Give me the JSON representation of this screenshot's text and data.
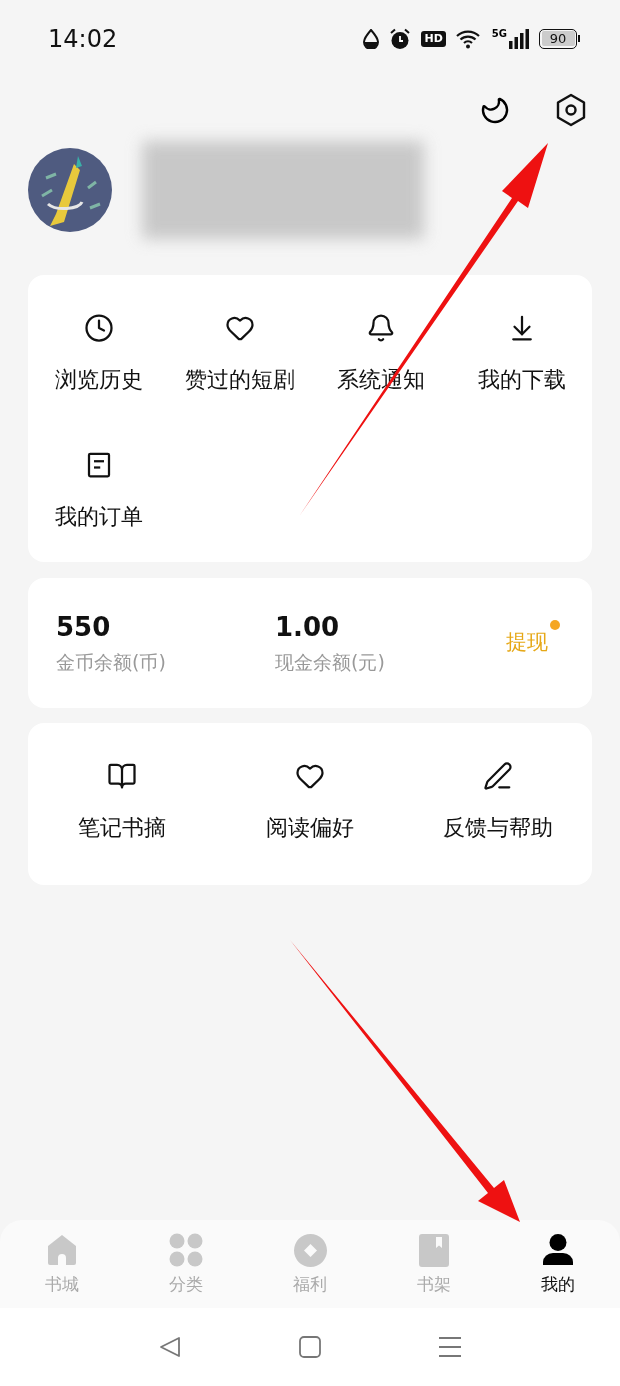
{
  "status_bar": {
    "time": "14:02",
    "hd": "HD",
    "network": "5G",
    "battery": "90"
  },
  "shortcuts": [
    {
      "label": "浏览历史"
    },
    {
      "label": "赞过的短剧"
    },
    {
      "label": "系统通知"
    },
    {
      "label": "我的下载"
    },
    {
      "label": "我的订单"
    }
  ],
  "balance": {
    "items": [
      {
        "value": "550",
        "label": "金币余额(币)"
      },
      {
        "value": "1.00",
        "label": "现金余额(元)"
      }
    ],
    "withdraw": {
      "label": "提现",
      "dot": true
    }
  },
  "tools": [
    {
      "label": "笔记书摘"
    },
    {
      "label": "阅读偏好"
    },
    {
      "label": "反馈与帮助"
    }
  ],
  "tab_bar": [
    {
      "label": "书城",
      "selected": false
    },
    {
      "label": "分类",
      "selected": false
    },
    {
      "label": "福利",
      "selected": false
    },
    {
      "label": "书架",
      "selected": false
    },
    {
      "label": "我的",
      "selected": true
    }
  ]
}
